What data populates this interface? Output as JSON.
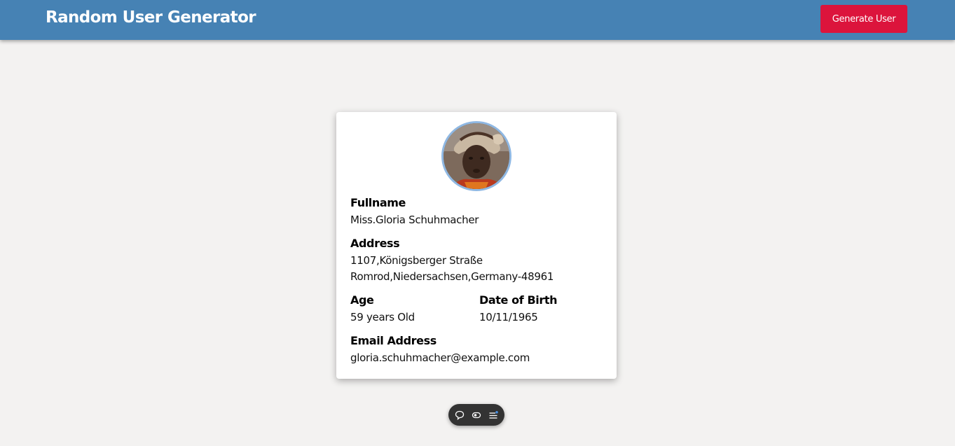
{
  "header": {
    "title": "Random User Generator",
    "generate_button_label": "Generate User",
    "background_color": "#4682b4",
    "button_color": "#dc143c"
  },
  "user_card": {
    "avatar_icon": "user-avatar",
    "fullname_label": "Fullname",
    "fullname_value": "Miss.Gloria Schuhmacher",
    "address_label": "Address",
    "address_line1": "1107,Königsberger Straße",
    "address_line2": "Romrod,Niedersachsen,Germany-48961",
    "age_label": "Age",
    "age_value": "59 years Old",
    "dob_label": "Date of Birth",
    "dob_value": "10/11/1965",
    "email_label": "Email Address",
    "email_value": "gloria.schuhmacher@example.com"
  },
  "floating_toolbar": {
    "items": [
      "comment-icon",
      "toggle-icon",
      "menu-icon"
    ]
  }
}
